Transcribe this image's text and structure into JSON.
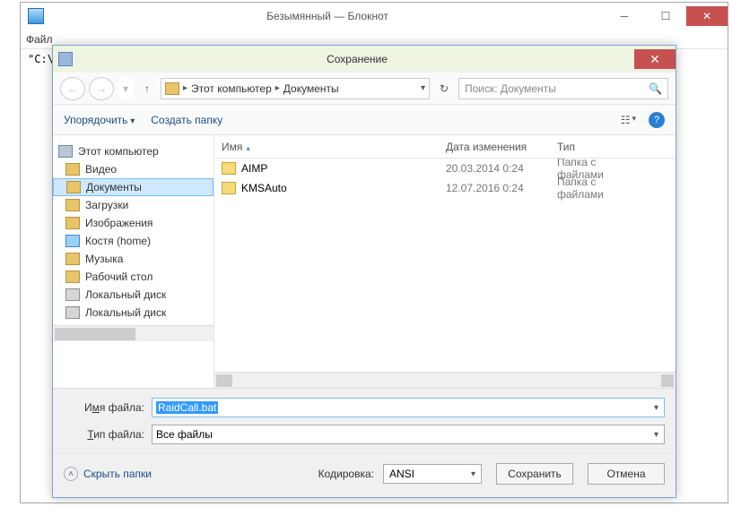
{
  "notepad": {
    "title": "Безымянный — Блокнот",
    "menu_file": "Файл",
    "text_line": "\"C:\\"
  },
  "dialog": {
    "title": "Сохранение",
    "breadcrumb": {
      "root": "Этот компьютер",
      "folder": "Документы"
    },
    "search_placeholder": "Поиск: Документы",
    "toolbar": {
      "organize": "Упорядочить",
      "new_folder": "Создать папку"
    },
    "tree": {
      "root": "Этот компьютер",
      "items": [
        "Видео",
        "Документы",
        "Загрузки",
        "Изображения",
        "Костя (home)",
        "Музыка",
        "Рабочий стол",
        "Локальный диск",
        "Локальный диск"
      ]
    },
    "columns": {
      "name": "Имя",
      "date": "Дата изменения",
      "type": "Тип"
    },
    "rows": [
      {
        "name": "AIMP",
        "date": "20.03.2014 0:24",
        "type": "Папка с файлами"
      },
      {
        "name": "KMSAuto",
        "date": "12.07.2016 0:24",
        "type": "Папка с файлами"
      }
    ],
    "filename_label_pre": "И",
    "filename_label_ul": "м",
    "filename_label_post": "я файла:",
    "filename_value": "RaidCall.bat",
    "filetype_label_ul": "Т",
    "filetype_label_post": "ип файла:",
    "filetype_value": "Все файлы",
    "hide_folders": "Скрыть папки",
    "encoding_label_ul": "К",
    "encoding_label_post": "одировка:",
    "encoding_value": "ANSI",
    "save": "Сохранить",
    "cancel": "Отмена"
  }
}
